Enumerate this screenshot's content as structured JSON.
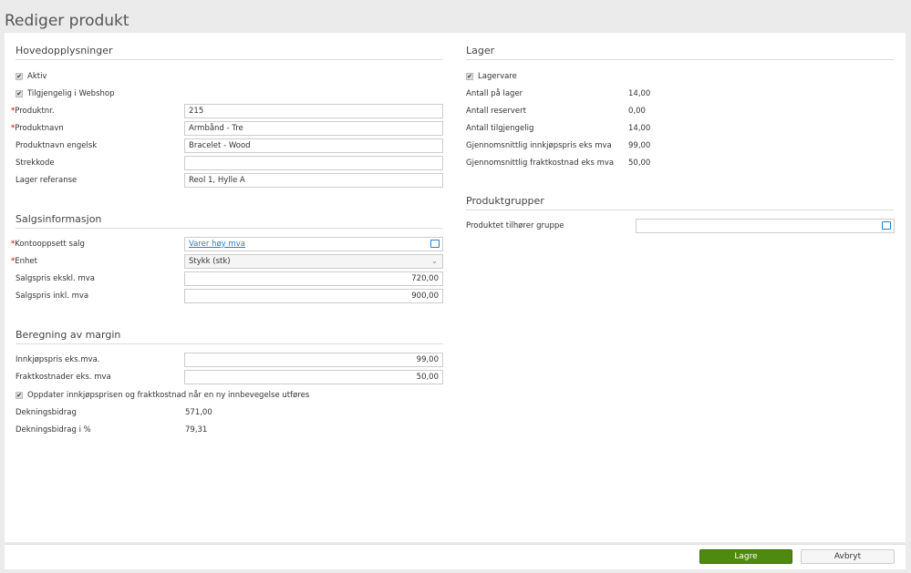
{
  "page_title": "Rediger produkt",
  "main": {
    "heading": "Hovedopplysninger",
    "aktiv": "Aktiv",
    "webshop": "Tilgjengelig i Webshop",
    "fields": [
      {
        "label": "Produktnr.",
        "value": "215",
        "required": true
      },
      {
        "label": "Produktnavn",
        "value": "Armbånd - Tre",
        "required": true
      },
      {
        "label": "Produktnavn engelsk",
        "value": "Bracelet - Wood"
      },
      {
        "label": "Strekkode",
        "value": ""
      },
      {
        "label": "Lager referanse",
        "value": "Reol 1, Hylle A"
      }
    ]
  },
  "sales": {
    "heading": "Salgsinformasjon",
    "account_label": "Kontooppsett salg",
    "account_value": "Varer høy mva",
    "unit_label": "Enhet",
    "unit_value": "Stykk (stk)",
    "price_ex_label": "Salgspris ekskl. mva",
    "price_ex": "720,00",
    "price_inc_label": "Salgspris inkl. mva",
    "price_inc": "900,00"
  },
  "margin": {
    "heading": "Beregning av margin",
    "cost_label": "Innkjøpspris eks.mva.",
    "cost": "99,00",
    "freight_label": "Fraktkostnader eks. mva",
    "freight": "50,00",
    "update_label": "Oppdater innkjøpsprisen og fraktkostnad når en ny innbevegelse utføres",
    "db_label": "Dekningsbidrag",
    "db": "571,00",
    "dbp_label": "Dekningsbidrag i %",
    "dbp": "79,31"
  },
  "stock": {
    "heading": "Lager",
    "lagervare": "Lagervare",
    "rows": [
      {
        "label": "Antall på lager",
        "value": "14,00"
      },
      {
        "label": "Antall reservert",
        "value": "0,00"
      },
      {
        "label": "Antall tilgjengelig",
        "value": "14,00"
      },
      {
        "label": "Gjennomsnittlig innkjøpspris eks mva",
        "value": "99,00"
      },
      {
        "label": "Gjennomsnittlig fraktkostnad eks mva",
        "value": "50,00"
      }
    ]
  },
  "groups": {
    "heading": "Produktgrupper",
    "label": "Produktet tilhører gruppe",
    "value": ""
  },
  "footer": {
    "save": "Lagre",
    "cancel": "Avbryt"
  },
  "colors": {
    "accent": "#2a7fc1",
    "save": "#4f8a10",
    "required": "#cc0000"
  }
}
